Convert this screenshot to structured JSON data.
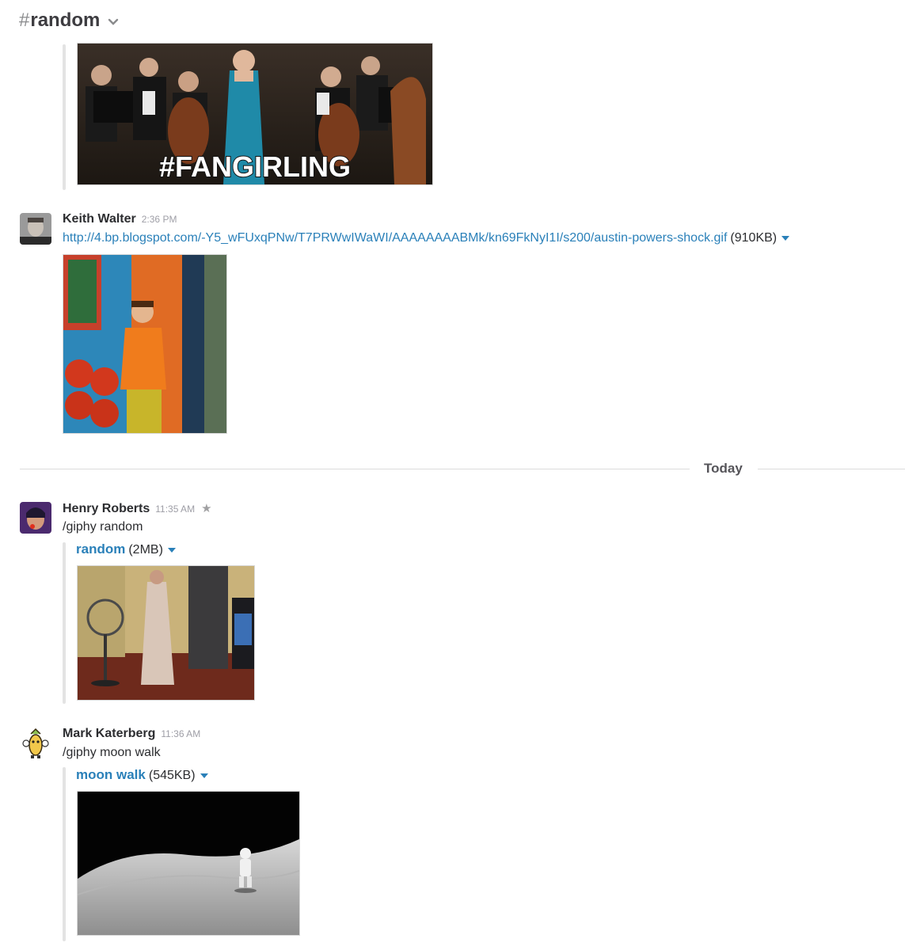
{
  "channel": {
    "hash": "#",
    "name": "random"
  },
  "top_attachment": {
    "caption": "#FANGIRLING"
  },
  "messages": [
    {
      "sender": "Keith Walter",
      "time": "2:36 PM",
      "link": "http://4.bp.blogspot.com/-Y5_wFUxqPNw/T7PRWwIWaWI/AAAAAAAABMk/kn69FkNyI1I/s200/austin-powers-shock.gif",
      "size": "(910KB)"
    },
    {
      "sender": "Henry Roberts",
      "time": "11:35 AM",
      "text": "/giphy random",
      "attachment_title": "random",
      "size": "(2MB)"
    },
    {
      "sender": "Mark Katerberg",
      "time": "11:36 AM",
      "text": "/giphy moon walk",
      "attachment_title": "moon walk",
      "size": "(545KB)"
    }
  ],
  "day_divider": "Today",
  "icons": [
    "chevron-down-icon",
    "star-icon",
    "dropdown-caret-icon"
  ],
  "colors": {
    "link": "#2a80b9",
    "timestamp": "#9e9ea6",
    "divider": "#dcdcdc"
  }
}
